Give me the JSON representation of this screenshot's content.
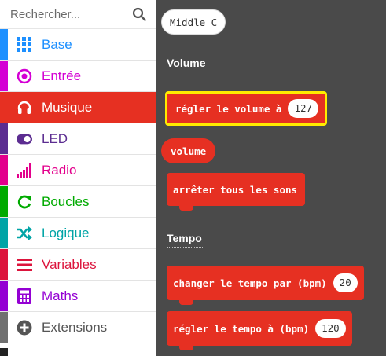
{
  "search": {
    "placeholder": "Rechercher..."
  },
  "categories": [
    {
      "label": "Base",
      "color": "#1e90ff",
      "icon": "grid-icon"
    },
    {
      "label": "Entrée",
      "color": "#d400d4",
      "icon": "radio-button-icon"
    },
    {
      "label": "Musique",
      "color": "#e63022",
      "icon": "headphones-icon",
      "selected": true
    },
    {
      "label": "LED",
      "color": "#5c2d91",
      "icon": "toggle-icon"
    },
    {
      "label": "Radio",
      "color": "#e3008c",
      "icon": "signal-bars-icon"
    },
    {
      "label": "Boucles",
      "color": "#00aa00",
      "icon": "refresh-icon"
    },
    {
      "label": "Logique",
      "color": "#00a4a6",
      "icon": "shuffle-icon"
    },
    {
      "label": "Variables",
      "color": "#dc143c",
      "icon": "list-icon"
    },
    {
      "label": "Maths",
      "color": "#9400d3",
      "icon": "calculator-icon"
    },
    {
      "label": "Extensions",
      "color": "#707070",
      "icon": "plus-circle-icon"
    }
  ],
  "workspace": {
    "note": "Middle C",
    "sections": [
      {
        "title": "Volume"
      },
      {
        "title": "Tempo"
      }
    ],
    "blocks": {
      "set_volume": {
        "label": "régler le volume à",
        "value": "127"
      },
      "volume": {
        "label": "volume"
      },
      "stop_all": {
        "label": "arrêter tous les sons"
      },
      "change_tempo": {
        "label": "changer le tempo par (bpm)",
        "value": "20"
      },
      "set_tempo": {
        "label": "régler le tempo à (bpm)",
        "value": "120"
      }
    }
  }
}
